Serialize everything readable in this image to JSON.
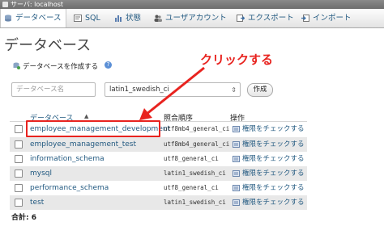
{
  "server_bar": {
    "text": "サーバ: localhost"
  },
  "tabs": [
    {
      "label": "データベース",
      "icon": "database-icon",
      "active": true
    },
    {
      "label": "SQL",
      "icon": "sql-icon",
      "active": false
    },
    {
      "label": "状態",
      "icon": "status-icon",
      "active": false
    },
    {
      "label": "ユーザアカウント",
      "icon": "users-icon",
      "active": false
    },
    {
      "label": "エクスポート",
      "icon": "export-icon",
      "active": false
    },
    {
      "label": "インポート",
      "icon": "import-icon",
      "active": false
    }
  ],
  "page_title": "データベース",
  "create_db": {
    "heading": "データベースを作成する",
    "help_glyph": "?",
    "name_placeholder": "データベース名",
    "collation_value": "latin1_swedish_ci",
    "create_label": "作成"
  },
  "table": {
    "headers": {
      "name": "データベース",
      "sort_arrow": "▲",
      "collation": "照合順序",
      "action": "操作"
    },
    "rows": [
      {
        "name": "employee_management_development",
        "collation": "utf8mb4_general_ci",
        "action": "権限をチェックする"
      },
      {
        "name": "employee_management_test",
        "collation": "utf8mb4_general_ci",
        "action": "権限をチェックする"
      },
      {
        "name": "information_schema",
        "collation": "utf8_general_ci",
        "action": "権限をチェックする"
      },
      {
        "name": "mysql",
        "collation": "latin1_swedish_ci",
        "action": "権限をチェックする"
      },
      {
        "name": "performance_schema",
        "collation": "utf8_general_ci",
        "action": "権限をチェックする"
      },
      {
        "name": "test",
        "collation": "latin1_swedish_ci",
        "action": "権限をチェックする"
      }
    ]
  },
  "total": "合計: 6",
  "annotation": {
    "text": "クリックする",
    "color": "#e8231f"
  },
  "colors": {
    "link": "#235a81",
    "accent_red": "#e8231f"
  }
}
